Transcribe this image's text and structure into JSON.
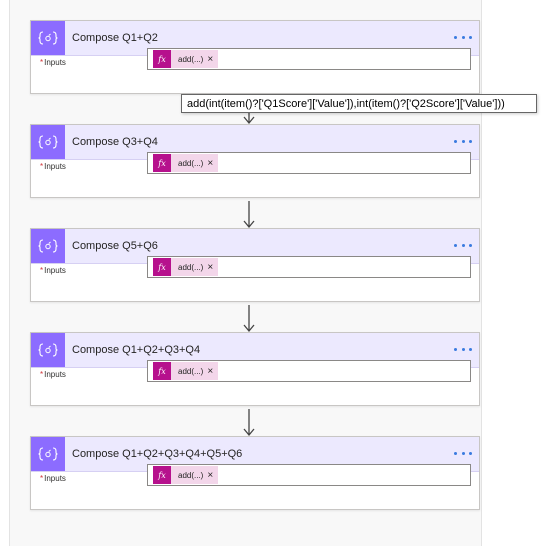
{
  "steps": [
    {
      "title": "Compose Q1+Q2",
      "inputs_label": "Inputs",
      "required_mark": "*",
      "token_text": "add(...)",
      "token_icon": "fx",
      "remove_icon": "×"
    },
    {
      "title": "Compose Q3+Q4",
      "inputs_label": "Inputs",
      "required_mark": "*",
      "token_text": "add(...)",
      "token_icon": "fx",
      "remove_icon": "×"
    },
    {
      "title": "Compose Q5+Q6",
      "inputs_label": "Inputs",
      "required_mark": "*",
      "token_text": "add(...)",
      "token_icon": "fx",
      "remove_icon": "×"
    },
    {
      "title": "Compose Q1+Q2+Q3+Q4",
      "inputs_label": "Inputs",
      "required_mark": "*",
      "token_text": "add(...)",
      "token_icon": "fx",
      "remove_icon": "×"
    },
    {
      "title": "Compose Q1+Q2+Q3+Q4+Q5+Q6",
      "inputs_label": "Inputs",
      "required_mark": "*",
      "token_text": "add(...)",
      "token_icon": "fx",
      "remove_icon": "×"
    }
  ],
  "tooltip": {
    "text": "add(int(item()?['Q1Score']['Value']),int(item()?['Q2Score']['Value']))"
  },
  "icons": {
    "action": "compose-braces-icon",
    "more": "more-options-icon",
    "connector": "arrow-down-icon",
    "token": "fx-expression-icon",
    "remove": "remove-token-icon"
  },
  "colors": {
    "action_accent": "#8c6cff",
    "header_background": "#ece9fe",
    "expression_token": "#b6118d",
    "token_background": "#f3d6ea",
    "more_dots": "#3a7be0",
    "required": "#d13438"
  }
}
